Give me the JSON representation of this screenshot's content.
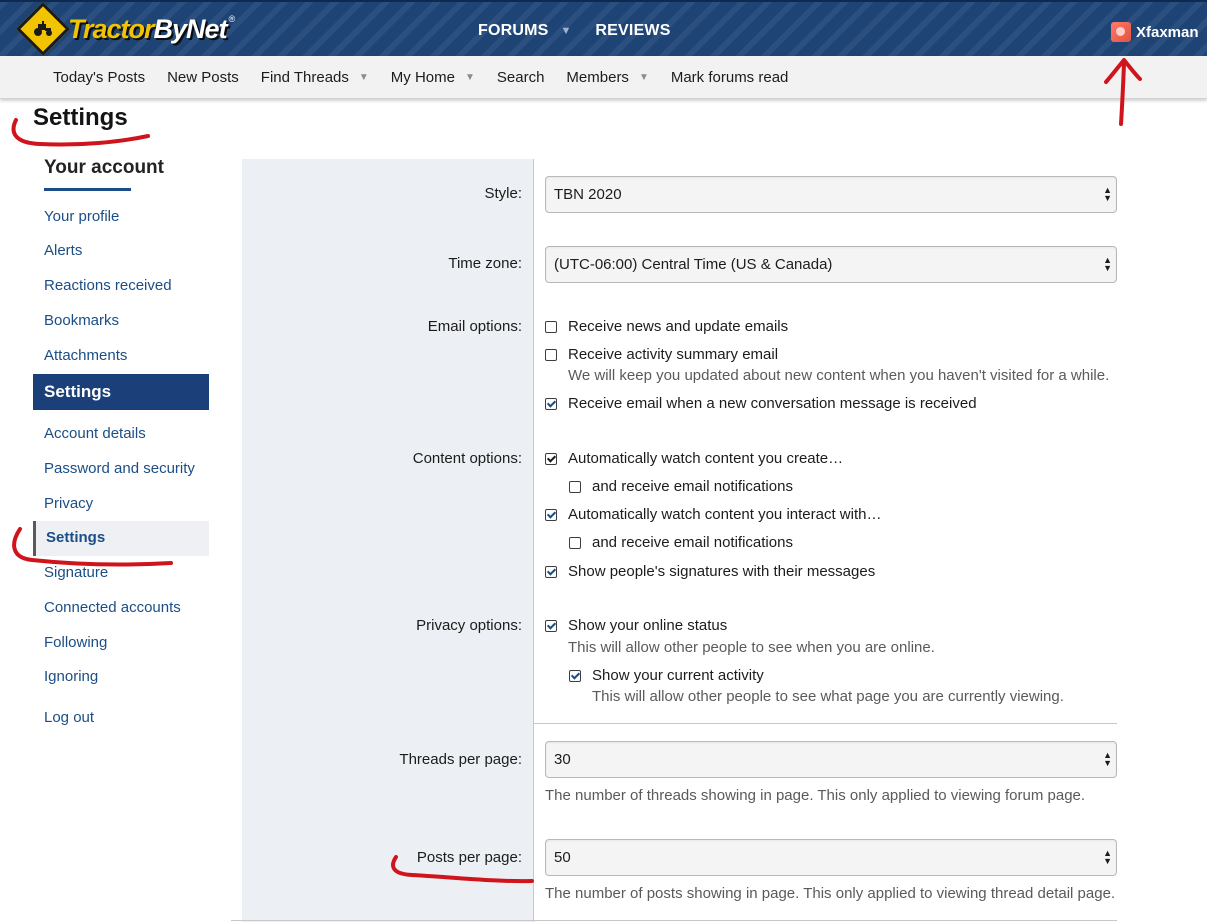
{
  "header": {
    "logo_text_a": "Tractor",
    "logo_text_b": "ByNet",
    "logo_tm": "®",
    "nav": [
      {
        "label": "FORUMS",
        "has_dropdown": true
      },
      {
        "label": "REVIEWS",
        "has_dropdown": false
      }
    ],
    "username": "Xfaxman"
  },
  "subnav": {
    "todays_posts": "Today's Posts",
    "new_posts": "New Posts",
    "find_threads": "Find Threads",
    "my_home": "My Home",
    "search": "Search",
    "members": "Members",
    "mark_read": "Mark forums read"
  },
  "page": {
    "title": "Settings"
  },
  "sidebar": {
    "heading": "Your account",
    "account_items": [
      "Your profile",
      "Alerts",
      "Reactions received",
      "Bookmarks",
      "Attachments"
    ],
    "section": "Settings",
    "settings_items": [
      "Account details",
      "Password and security",
      "Privacy"
    ],
    "active_item": "Settings",
    "more_items": [
      "Signature",
      "Connected accounts",
      "Following",
      "Ignoring"
    ],
    "logout": "Log out"
  },
  "form": {
    "style": {
      "label": "Style:",
      "value": "TBN 2020"
    },
    "timezone": {
      "label": "Time zone:",
      "value": "(UTC-06:00) Central Time (US & Canada)"
    },
    "email": {
      "label": "Email options:",
      "news": {
        "text": "Receive news and update emails",
        "checked": false
      },
      "summary": {
        "text": "Receive activity summary email",
        "checked": false,
        "hint": "We will keep you updated about new content when you haven't visited for a while."
      },
      "conversation": {
        "text": "Receive email when a new conversation message is received",
        "checked": true
      }
    },
    "content": {
      "label": "Content options:",
      "watch_create": {
        "text": "Automatically watch content you create…",
        "checked": true
      },
      "watch_create_email": {
        "text": "and receive email notifications",
        "checked": false
      },
      "watch_interact": {
        "text": "Automatically watch content you interact with…",
        "checked": true
      },
      "watch_interact_email": {
        "text": "and receive email notifications",
        "checked": false
      },
      "signatures": {
        "text": "Show people's signatures with their messages",
        "checked": true
      }
    },
    "privacy": {
      "label": "Privacy options:",
      "online": {
        "text": "Show your online status",
        "checked": true,
        "hint": "This will allow other people to see when you are online."
      },
      "activity": {
        "text": "Show your current activity",
        "checked": true,
        "hint": "This will allow other people to see what page you are currently viewing."
      }
    },
    "threads": {
      "label": "Threads per page:",
      "value": "30",
      "hint": "The number of threads showing in page. This only applied to viewing forum page."
    },
    "posts": {
      "label": "Posts per page:",
      "value": "50",
      "hint": "The number of posts showing in page. This only applied to viewing thread detail page."
    }
  },
  "colors": {
    "header_bg": "#1e4476",
    "link": "#1b4e86",
    "sidebar_section_bg": "#1b4079",
    "annotation_red": "#d0141c"
  }
}
